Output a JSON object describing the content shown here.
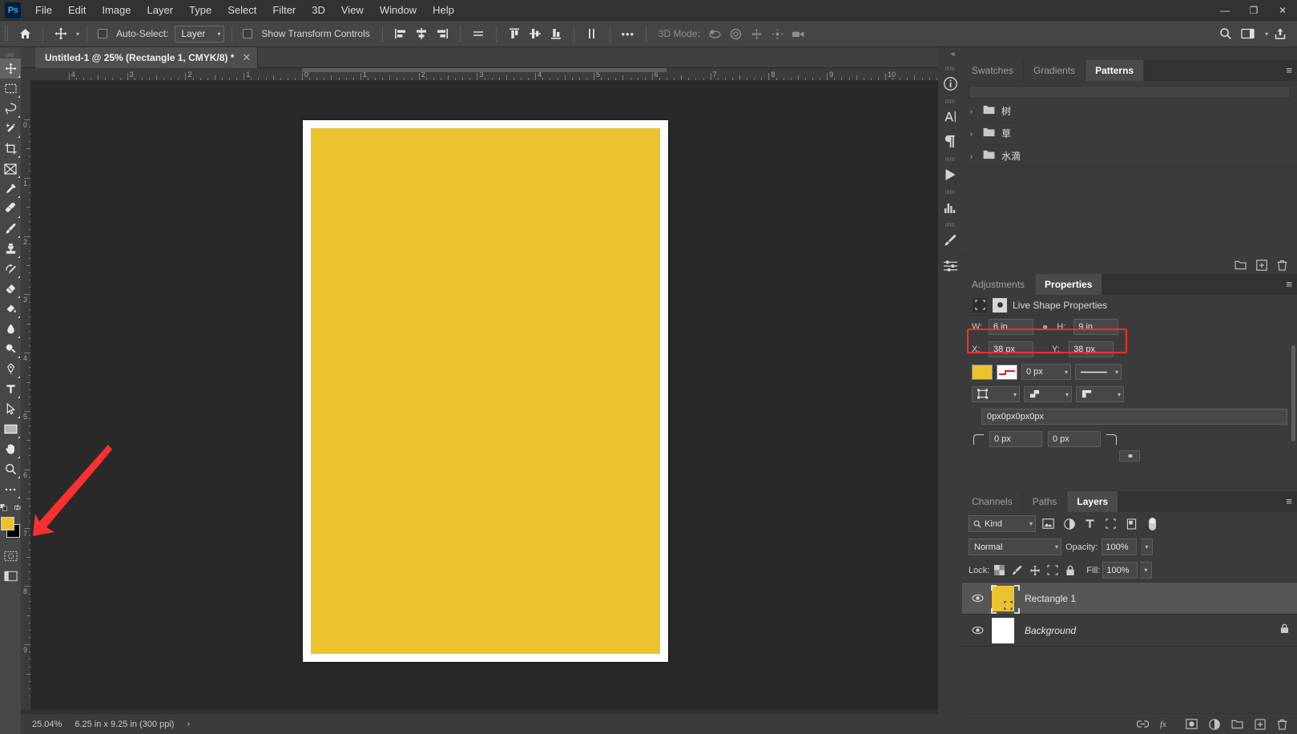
{
  "app": {
    "name": "Adobe Photoshop",
    "logo_text": "Ps"
  },
  "menubar": {
    "items": [
      {
        "label": "File"
      },
      {
        "label": "Edit"
      },
      {
        "label": "Image"
      },
      {
        "label": "Layer"
      },
      {
        "label": "Type"
      },
      {
        "label": "Select"
      },
      {
        "label": "Filter"
      },
      {
        "label": "3D"
      },
      {
        "label": "View"
      },
      {
        "label": "Window"
      },
      {
        "label": "Help"
      }
    ],
    "window_controls": {
      "minimize": "—",
      "maximize": "❐",
      "close": "✕"
    }
  },
  "options_bar": {
    "home_icon": "home-icon",
    "tool_icon": "move-tool-icon",
    "auto_select_label": "Auto-Select:",
    "auto_select_value": "Layer",
    "show_transform_label": "Show Transform Controls",
    "align_icons": [
      "align-left-edges-icon",
      "align-horizontal-centers-icon",
      "align-right-edges-icon",
      "distribute-horizontally-icon"
    ],
    "align_icons2": [
      "align-top-edges-icon",
      "align-vertical-centers-icon",
      "align-bottom-edges-icon",
      "distribute-vertically-icon"
    ],
    "more_label": "•••",
    "mode_3d_label": "3D Mode:",
    "mode_3d_icons": [
      "orbit-3d-icon",
      "roll-3d-icon",
      "pan-3d-icon",
      "slide-3d-icon",
      "camera-3d-icon"
    ],
    "right_icons": [
      "search-icon",
      "workspace-icon",
      "share-icon"
    ]
  },
  "document": {
    "tab_title": "Untitled-1 @ 25% (Rectangle 1, CMYK/8) *",
    "close_glyph": "✕",
    "ruler_h_labels": [
      "4",
      "3",
      "2",
      "1",
      "0",
      "1",
      "2",
      "3",
      "4",
      "5",
      "6",
      "7",
      "8",
      "9",
      "10"
    ],
    "ruler_v_labels": [
      "0",
      "1",
      "2",
      "3",
      "4",
      "5",
      "6",
      "7",
      "8",
      "9"
    ],
    "shape_fill_color": "#ebc32f",
    "page_color": "#fdfdfd",
    "canvas_bg": "#292929",
    "annotation": {
      "type": "arrow",
      "color": "#fc3030",
      "points_to": "rectangle-tool"
    }
  },
  "statusbar": {
    "zoom": "25.04%",
    "dimensions": "6.25 in x 9.25 in (300 ppi)",
    "expand_glyph": "›"
  },
  "toolbar": {
    "tools": [
      {
        "name": "move-tool",
        "label": "Move Tool",
        "active": true
      },
      {
        "name": "rectangular-marquee-tool",
        "label": "Rectangular Marquee Tool"
      },
      {
        "name": "lasso-tool",
        "label": "Lasso Tool"
      },
      {
        "name": "object-selection-tool",
        "label": "Object Selection Tool"
      },
      {
        "name": "crop-tool",
        "label": "Crop Tool"
      },
      {
        "name": "frame-tool",
        "label": "Frame Tool"
      },
      {
        "name": "eyedropper-tool",
        "label": "Eyedropper Tool"
      },
      {
        "name": "spot-healing-brush-tool",
        "label": "Spot Healing Brush Tool"
      },
      {
        "name": "brush-tool",
        "label": "Brush Tool"
      },
      {
        "name": "clone-stamp-tool",
        "label": "Clone Stamp Tool"
      },
      {
        "name": "history-brush-tool",
        "label": "History Brush Tool"
      },
      {
        "name": "eraser-tool",
        "label": "Eraser Tool"
      },
      {
        "name": "gradient-tool",
        "label": "Gradient Tool"
      },
      {
        "name": "blur-tool",
        "label": "Blur Tool"
      },
      {
        "name": "dodge-tool",
        "label": "Dodge Tool"
      },
      {
        "name": "pen-tool",
        "label": "Pen Tool"
      },
      {
        "name": "type-tool",
        "label": "Horizontal Type Tool"
      },
      {
        "name": "path-selection-tool",
        "label": "Path Selection Tool"
      },
      {
        "name": "rectangle-tool",
        "label": "Rectangle Tool",
        "selected": true
      },
      {
        "name": "hand-tool",
        "label": "Hand Tool"
      },
      {
        "name": "zoom-tool",
        "label": "Zoom Tool"
      },
      {
        "name": "edit-toolbar",
        "label": "Edit Toolbar"
      }
    ],
    "foreground_color": "#ebc32f",
    "background_color": "#000000",
    "quick_mask_label": "Quick Mask Mode"
  },
  "right_dock": {
    "collapse_glyph": "«",
    "rail_icons": [
      {
        "name": "info-icon",
        "glyph": "i"
      },
      {
        "name": "character-icon",
        "glyph": "A"
      },
      {
        "name": "paragraph-icon",
        "glyph": "¶"
      },
      {
        "name": "timeline-icon",
        "glyph": "▶"
      },
      {
        "name": "histogram-icon",
        "glyph": "histogram"
      },
      {
        "name": "brush-settings-icon",
        "glyph": "brush"
      },
      {
        "name": "adjust-icon",
        "glyph": "sliders"
      }
    ]
  },
  "patterns_panel": {
    "tabs": [
      {
        "label": "Swatches",
        "selected": false
      },
      {
        "label": "Gradients",
        "selected": false
      },
      {
        "label": "Patterns",
        "selected": true
      }
    ],
    "menu_glyph": "≡",
    "folders": [
      {
        "name": "树",
        "twisty": "›"
      },
      {
        "name": "草",
        "twisty": "›"
      },
      {
        "name": "水滴",
        "twisty": "›"
      }
    ],
    "footer_icons": [
      "new-folder-icon",
      "new-pattern-icon",
      "delete-icon"
    ]
  },
  "properties_panel": {
    "tabs": [
      {
        "label": "Adjustments",
        "selected": false
      },
      {
        "label": "Properties",
        "selected": true
      }
    ],
    "menu_glyph": "≡",
    "header": "Live Shape Properties",
    "header_icons": [
      "shape-transform-icon",
      "mask-icon"
    ],
    "width_label": "W:",
    "width_value": "6 in",
    "height_label": "H:",
    "height_value": "9 in",
    "link_glyph": "⚭",
    "x_label": "X:",
    "x_value": "38 px",
    "y_label": "Y:",
    "y_value": "38 px",
    "fill_color": "#ebc32f",
    "stroke_width": "0 px",
    "stroke_style": "solid-line",
    "stroke_align": "stroke-align-icon",
    "stroke_caps": "stroke-caps-icon",
    "stroke_corners": "stroke-corners-icon",
    "corner_radius_combined": "0px0px0px0px",
    "corner_radius_1": "0 px",
    "corner_radius_2": "0 px",
    "radius_link_glyph": "⚭",
    "highlight_color": "#ff2d2d"
  },
  "layers_panel": {
    "tabs": [
      {
        "label": "Channels",
        "selected": false
      },
      {
        "label": "Paths",
        "selected": false
      },
      {
        "label": "Layers",
        "selected": true
      }
    ],
    "menu_glyph": "≡",
    "filter_label": "Kind",
    "filter_icons": [
      "filter-pixel-icon",
      "filter-adjustment-icon",
      "filter-type-icon",
      "filter-shape-icon",
      "filter-smart-object-icon"
    ],
    "filter_toggle": "filter-toggle-icon",
    "blend_mode": "Normal",
    "opacity_label": "Opacity:",
    "opacity_value": "100%",
    "lock_label": "Lock:",
    "lock_icons": [
      "lock-transparent-pixels-icon",
      "lock-image-pixels-icon",
      "lock-position-icon",
      "lock-artboard-nesting-icon",
      "lock-all-icon"
    ],
    "fill_label": "Fill:",
    "fill_value": "100%",
    "layers": [
      {
        "name": "Rectangle 1",
        "selected": true,
        "visible": true,
        "thumb_color": "#ebc32f",
        "italic": false,
        "locked": false,
        "badge": "shape-layer-badge"
      },
      {
        "name": "Background",
        "selected": false,
        "visible": true,
        "thumb_color": "#ffffff",
        "italic": true,
        "locked": true,
        "badge": ""
      }
    ],
    "footer_icons": [
      "link-layers-icon",
      "layer-style-icon",
      "layer-mask-icon",
      "adjustment-layer-icon",
      "new-group-icon",
      "new-layer-icon",
      "delete-layer-icon"
    ]
  }
}
